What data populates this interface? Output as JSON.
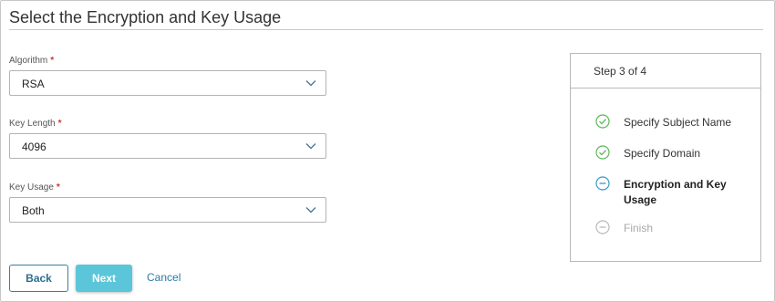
{
  "page": {
    "title": "Select the Encryption and Key Usage"
  },
  "form": {
    "algorithm": {
      "label": "Algorithm",
      "required_mark": "*",
      "value": "RSA"
    },
    "key_length": {
      "label": "Key Length",
      "required_mark": "*",
      "value": "4096"
    },
    "key_usage": {
      "label": "Key Usage",
      "required_mark": "*",
      "value": "Both"
    }
  },
  "actions": {
    "back_label": "Back",
    "next_label": "Next",
    "cancel_label": "Cancel"
  },
  "steps": {
    "header": "Step 3 of 4",
    "items": [
      {
        "label": "Specify Subject Name",
        "state": "complete",
        "icon": "check-circle-icon"
      },
      {
        "label": "Specify Domain",
        "state": "complete",
        "icon": "check-circle-icon"
      },
      {
        "label": "Encryption and Key Usage",
        "state": "current",
        "icon": "minus-circle-icon"
      },
      {
        "label": "Finish",
        "state": "pending",
        "icon": "minus-circle-icon"
      }
    ]
  },
  "colors": {
    "complete": "#5cb85c",
    "current": "#3a9bbf",
    "pending": "#bbbbbb",
    "primary_button": "#5bc6da",
    "link": "#2a7ca3",
    "required": "#d0342c"
  }
}
